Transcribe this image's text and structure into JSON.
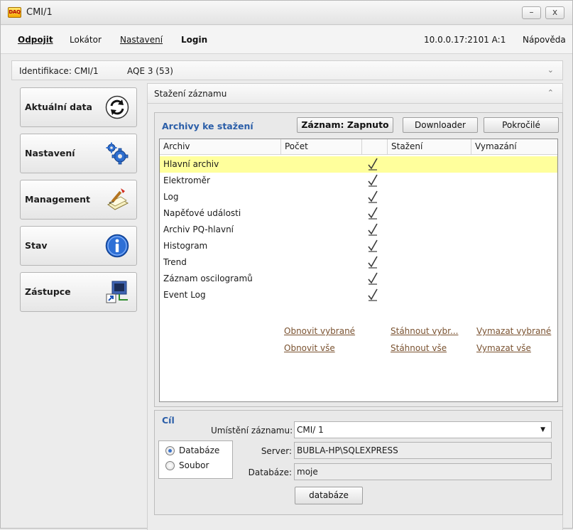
{
  "window": {
    "title": "CMI/1",
    "app_badge": "DAQ",
    "minimize": "–",
    "close": "x"
  },
  "menu": {
    "disconnect": "Odpojit",
    "locator": "Lokátor",
    "settings": "Nastavení",
    "login": "Login",
    "connection": "10.0.0.17:2101 A:1",
    "help": "Nápověda"
  },
  "ident": {
    "label": "Identifikace: CMI/1",
    "model": "AQE 3 (53)"
  },
  "nav": [
    {
      "label": "Aktuální data",
      "icon": "refresh-icon"
    },
    {
      "label": "Nastavení",
      "icon": "gears-icon"
    },
    {
      "label": "Management",
      "icon": "management-icon"
    },
    {
      "label": "Stav",
      "icon": "info-icon"
    },
    {
      "label": "Zástupce",
      "icon": "shortcut-icon"
    }
  ],
  "panel": {
    "title": "Stažení záznamu"
  },
  "archives": {
    "title": "Archivy ke stažení",
    "btn_record": "Záznam: Zapnuto",
    "btn_downloader": "Downloader",
    "btn_advanced": "Pokročilé",
    "columns": [
      "Archiv",
      "Počet",
      "",
      "Stažení",
      "Vymazání"
    ],
    "rows": [
      {
        "name": "Hlavní archiv",
        "checked": true
      },
      {
        "name": "Elektroměr",
        "checked": true
      },
      {
        "name": "Log",
        "checked": true
      },
      {
        "name": "Napěťové události",
        "checked": true
      },
      {
        "name": "Archiv PQ-hlavní",
        "checked": true
      },
      {
        "name": "Histogram",
        "checked": true
      },
      {
        "name": "Trend",
        "checked": true
      },
      {
        "name": "Záznam oscilogramů",
        "checked": true
      },
      {
        "name": "Event Log",
        "checked": true
      }
    ],
    "links": {
      "refresh_selected": "Obnovit vybrané",
      "download_selected": "Stáhnout vybr...",
      "delete_selected": "Vymazat vybrané",
      "refresh_all": "Obnovit vše",
      "download_all": "Stáhnout vše",
      "delete_all": "Vymazat vše"
    }
  },
  "target": {
    "title": "Cíl",
    "radio_db": "Databáze",
    "radio_file": "Soubor",
    "location_label": "Umístění záznamu:",
    "location_value": "CMI/ 1",
    "server_label": "Server:",
    "server_value": "BUBLA-HP\\SQLEXPRESS",
    "db_label": "Databáze:",
    "db_value": "moje",
    "db_button": "databáze"
  },
  "colors": {
    "accent": "#2b5ea8",
    "selected_row": "#ffff9c",
    "link": "#7a5230"
  }
}
